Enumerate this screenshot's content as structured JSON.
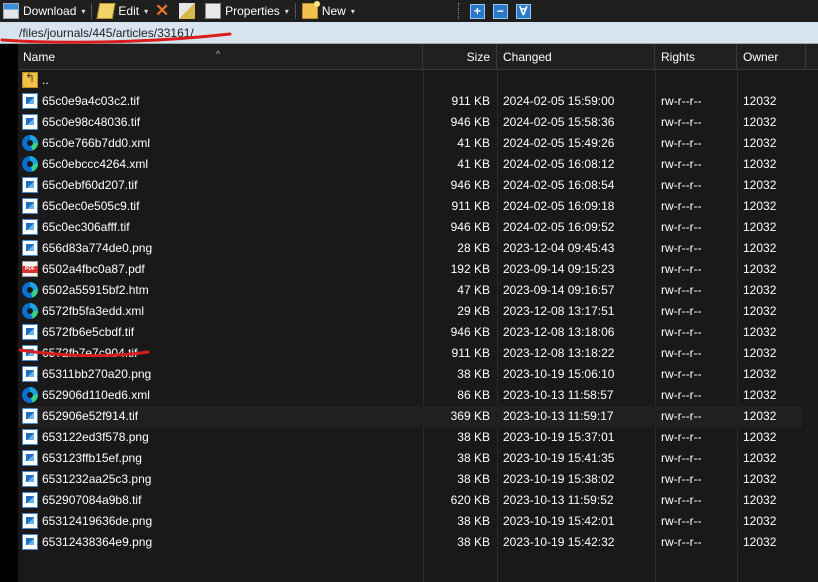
{
  "toolbar": {
    "download_label": "Download",
    "edit_label": "Edit",
    "properties_label": "Properties",
    "new_label": "New",
    "dropdown_arrow": "▾",
    "icons": [
      "download-icon",
      "edit-icon",
      "delete-icon",
      "rename-icon",
      "properties-icon",
      "new-folder-icon",
      "select-all-icon",
      "unselect-icon",
      "filter-icon"
    ]
  },
  "path": {
    "current": "/files/journals/445/articles/33161/"
  },
  "columns": {
    "name": "Name",
    "size": "Size",
    "changed": "Changed",
    "rights": "Rights",
    "owner": "Owner",
    "sort_indicator": "^"
  },
  "files": [
    {
      "name": "..",
      "size": "",
      "changed": "",
      "rights": "",
      "owner": "",
      "type": "up"
    },
    {
      "name": "65c0e9a4c03c2.tif",
      "size": "911 KB",
      "changed": "2024-02-05 15:59:00",
      "rights": "rw-r--r--",
      "owner": "12032",
      "type": "tif"
    },
    {
      "name": "65c0e98c48036.tif",
      "size": "946 KB",
      "changed": "2024-02-05 15:58:36",
      "rights": "rw-r--r--",
      "owner": "12032",
      "type": "tif"
    },
    {
      "name": "65c0e766b7dd0.xml",
      "size": "41 KB",
      "changed": "2024-02-05 15:49:26",
      "rights": "rw-r--r--",
      "owner": "12032",
      "type": "xml"
    },
    {
      "name": "65c0ebccc4264.xml",
      "size": "41 KB",
      "changed": "2024-02-05 16:08:12",
      "rights": "rw-r--r--",
      "owner": "12032",
      "type": "xml"
    },
    {
      "name": "65c0ebf60d207.tif",
      "size": "946 KB",
      "changed": "2024-02-05 16:08:54",
      "rights": "rw-r--r--",
      "owner": "12032",
      "type": "tif"
    },
    {
      "name": "65c0ec0e505c9.tif",
      "size": "911 KB",
      "changed": "2024-02-05 16:09:18",
      "rights": "rw-r--r--",
      "owner": "12032",
      "type": "tif"
    },
    {
      "name": "65c0ec306afff.tif",
      "size": "946 KB",
      "changed": "2024-02-05 16:09:52",
      "rights": "rw-r--r--",
      "owner": "12032",
      "type": "tif"
    },
    {
      "name": "656d83a774de0.png",
      "size": "28 KB",
      "changed": "2023-12-04 09:45:43",
      "rights": "rw-r--r--",
      "owner": "12032",
      "type": "png"
    },
    {
      "name": "6502a4fbc0a87.pdf",
      "size": "192 KB",
      "changed": "2023-09-14 09:15:23",
      "rights": "rw-r--r--",
      "owner": "12032",
      "type": "pdf"
    },
    {
      "name": "6502a55915bf2.htm",
      "size": "47 KB",
      "changed": "2023-09-14 09:16:57",
      "rights": "rw-r--r--",
      "owner": "12032",
      "type": "htm"
    },
    {
      "name": "6572fb5fa3edd.xml",
      "size": "29 KB",
      "changed": "2023-12-08 13:17:51",
      "rights": "rw-r--r--",
      "owner": "12032",
      "type": "xml"
    },
    {
      "name": "6572fb6e5cbdf.tif",
      "size": "946 KB",
      "changed": "2023-12-08 13:18:06",
      "rights": "rw-r--r--",
      "owner": "12032",
      "type": "tif"
    },
    {
      "name": "6572fb7e7c904.tif",
      "size": "911 KB",
      "changed": "2023-12-08 13:18:22",
      "rights": "rw-r--r--",
      "owner": "12032",
      "type": "tif"
    },
    {
      "name": "65311bb270a20.png",
      "size": "38 KB",
      "changed": "2023-10-19 15:06:10",
      "rights": "rw-r--r--",
      "owner": "12032",
      "type": "png"
    },
    {
      "name": "652906d110ed6.xml",
      "size": "86 KB",
      "changed": "2023-10-13 11:58:57",
      "rights": "rw-r--r--",
      "owner": "12032",
      "type": "xml"
    },
    {
      "name": "652906e52f914.tif",
      "size": "369 KB",
      "changed": "2023-10-13 11:59:17",
      "rights": "rw-r--r--",
      "owner": "12032",
      "type": "tif"
    },
    {
      "name": "653122ed3f578.png",
      "size": "38 KB",
      "changed": "2023-10-19 15:37:01",
      "rights": "rw-r--r--",
      "owner": "12032",
      "type": "png"
    },
    {
      "name": "653123ffb15ef.png",
      "size": "38 KB",
      "changed": "2023-10-19 15:41:35",
      "rights": "rw-r--r--",
      "owner": "12032",
      "type": "png"
    },
    {
      "name": "6531232aa25c3.png",
      "size": "38 KB",
      "changed": "2023-10-19 15:38:02",
      "rights": "rw-r--r--",
      "owner": "12032",
      "type": "png"
    },
    {
      "name": "652907084a9b8.tif",
      "size": "620 KB",
      "changed": "2023-10-13 11:59:52",
      "rights": "rw-r--r--",
      "owner": "12032",
      "type": "tif"
    },
    {
      "name": "65312419636de.png",
      "size": "38 KB",
      "changed": "2023-10-19 15:42:01",
      "rights": "rw-r--r--",
      "owner": "12032",
      "type": "png"
    },
    {
      "name": "65312438364e9.png",
      "size": "38 KB",
      "changed": "2023-10-19 15:42:32",
      "rights": "rw-r--r--",
      "owner": "12032",
      "type": "png"
    }
  ],
  "colors": {
    "annotation": "#d81e1e",
    "path_bg": "#d7e3ef",
    "list_bg": "#191919",
    "header_bg": "#202020"
  }
}
